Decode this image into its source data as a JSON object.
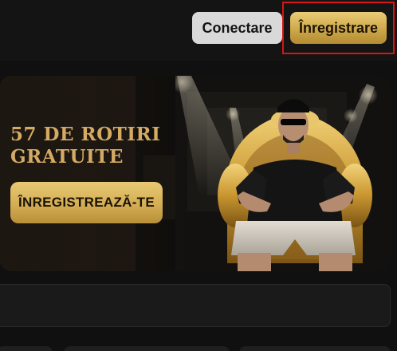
{
  "header": {
    "login_label": "Conectare",
    "register_label": "Înregistrare"
  },
  "banner": {
    "title": "57 DE ROTIRI GRATUITE",
    "cta_label": "ÎNREGISTREAZĂ-TE"
  },
  "colors": {
    "accent_gold": "#d4ab63",
    "button_gold": "#d4ad55",
    "highlight": "#d81414",
    "background": "#101010"
  }
}
